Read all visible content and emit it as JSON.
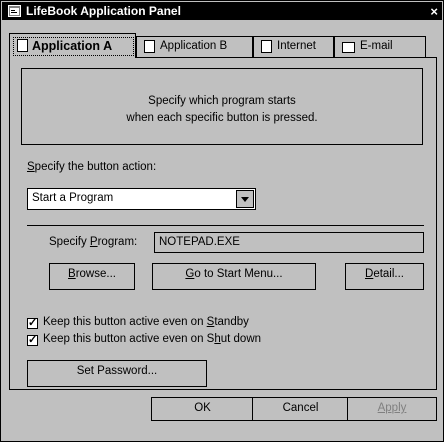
{
  "window": {
    "title": "LifeBook Application Panel",
    "close_glyph": "×"
  },
  "tabs": [
    {
      "label": "Application A",
      "icon": "document-icon",
      "active": true
    },
    {
      "label": "Application B",
      "icon": "document-icon",
      "active": false
    },
    {
      "label": "Internet",
      "icon": "document-icon",
      "active": false
    },
    {
      "label": "E-mail",
      "icon": "card-icon",
      "active": false
    }
  ],
  "info": {
    "line1": "Specify which program starts",
    "line2": "when each specific button is pressed."
  },
  "button_action": {
    "label_mnemonic": "S",
    "label_rest": "pecify the button action:",
    "selected": "Start a Program"
  },
  "program": {
    "label_prefix": "Specify ",
    "label_mnemonic": "P",
    "label_rest": "rogram:",
    "value": "NOTEPAD.EXE"
  },
  "buttons": {
    "browse": {
      "mnemonic": "B",
      "rest": "rowse..."
    },
    "start_menu": {
      "mnemonic": "G",
      "rest": "o to Start Menu..."
    },
    "detail": {
      "mnemonic": "D",
      "rest": "etail..."
    },
    "set_password": "Set Password..."
  },
  "checkboxes": [
    {
      "prefix": "Keep this button active even on ",
      "mnemonic": "S",
      "rest": "tandby",
      "checked": true
    },
    {
      "prefix": "Keep this button active even on S",
      "mnemonic": "h",
      "rest": "ut down",
      "checked": true
    }
  ],
  "footer": {
    "ok": "OK",
    "cancel": "Cancel",
    "apply": "Apply"
  }
}
